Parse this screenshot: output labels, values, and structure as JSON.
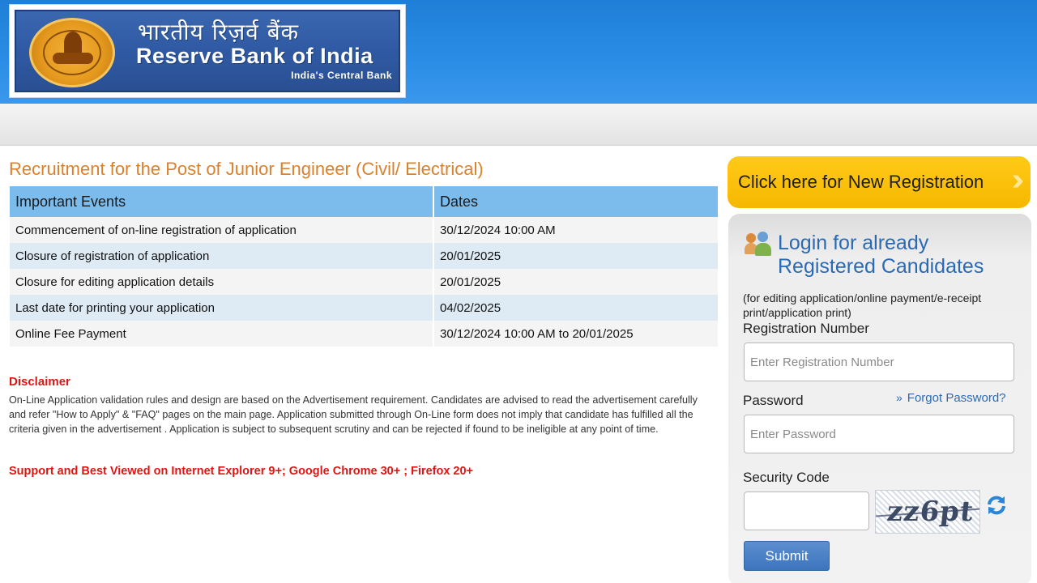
{
  "header": {
    "logo_hindi": "भारतीय रिज़र्व बैंक",
    "logo_english": "Reserve Bank of India",
    "logo_tagline": "India's Central Bank"
  },
  "page": {
    "title": "Recruitment for the Post of Junior Engineer (Civil/ Electrical)"
  },
  "events_table": {
    "headers": [
      "Important Events",
      "Dates"
    ],
    "rows": [
      {
        "event": "Commencement of on-line registration of application",
        "date": "30/12/2024 10:00 AM"
      },
      {
        "event": "Closure of registration of application",
        "date": "20/01/2025"
      },
      {
        "event": "Closure for editing application details",
        "date": "20/01/2025"
      },
      {
        "event": "Last date for printing your application",
        "date": "04/02/2025"
      },
      {
        "event": "Online Fee Payment",
        "date": "30/12/2024 10:00 AM to 20/01/2025"
      }
    ]
  },
  "disclaimer": {
    "title": "Disclaimer",
    "text": "On-Line Application validation rules and design are based on the Advertisement requirement. Candidates are advised to read the advertisement carefully and refer \"How to Apply\" & \"FAQ\" pages on the main page. Application submitted through On-Line form does not imply that candidate has fulfilled all the criteria given in the advertisement . Application is subject to subsequent scrutiny and can be rejected if found to be ineligible at any point of time.",
    "support_note": "Support and Best Viewed on Internet Explorer 9+; Google Chrome 30+ ; Firefox 20+"
  },
  "sidebar": {
    "new_registration_label": "Click here for New Registration",
    "login": {
      "title": "Login for already Registered Candidates",
      "subtitle": "(for editing application/online payment/e-receipt print/application print)",
      "registration_label": "Registration Number",
      "registration_placeholder": "Enter Registration Number",
      "registration_value": "",
      "password_label": "Password",
      "password_placeholder": "Enter Password",
      "password_value": "",
      "forgot_password": "Forgot Password?",
      "security_code_label": "Security Code",
      "security_code_value": "",
      "captcha_text": "zz6pt",
      "submit_label": "Submit"
    }
  },
  "colors": {
    "header_blue": "#2b8de6",
    "title_orange": "#d9822b",
    "table_header": "#7cbcec",
    "alert_red": "#e01414",
    "cta_yellow": "#ffca18",
    "link_blue": "#2a6ab5"
  }
}
